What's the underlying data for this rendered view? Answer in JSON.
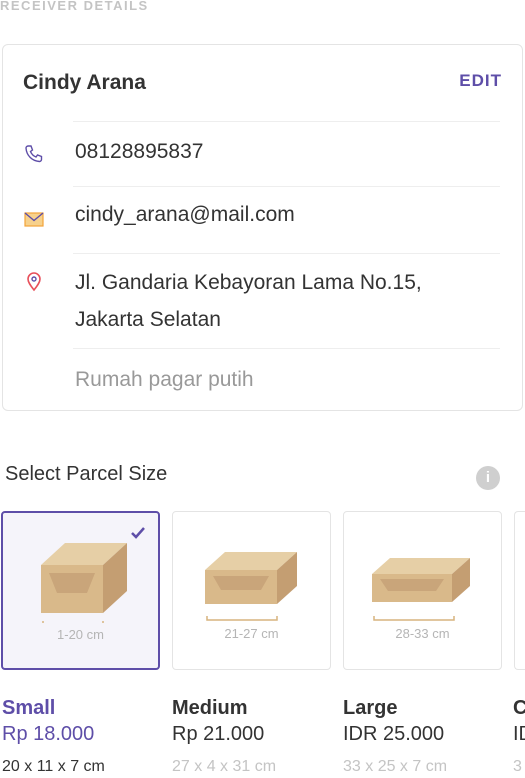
{
  "section_label": "RECEIVER DETAILS",
  "receiver": {
    "name": "Cindy Arana",
    "edit_label": "EDIT",
    "phone": "08128895837",
    "email": "cindy_arana@mail.com",
    "address_line1": "Jl. Gandaria Kebayoran Lama No.15,",
    "address_line2": "Jakarta Selatan",
    "note": "Rumah pagar putih"
  },
  "parcel": {
    "title": "Select Parcel Size",
    "info_icon": "i",
    "sizes": [
      {
        "name": "Small",
        "price": "Rp 18.000",
        "dimensions": "20 x 11 x 7 cm",
        "range": "1-20 cm",
        "selected": true
      },
      {
        "name": "Medium",
        "price": "Rp 21.000",
        "dimensions": "27 x 4 x 31 cm",
        "range": "21-27 cm",
        "selected": false
      },
      {
        "name": "Large",
        "price": "IDR 25.000",
        "dimensions": "33 x 25 x 7 cm",
        "range": "28-33 cm",
        "selected": false
      },
      {
        "name": "C",
        "price": "ID",
        "dimensions": "3",
        "range": "",
        "selected": false
      }
    ]
  },
  "colors": {
    "accent": "#5e4ea8",
    "location_pin": "#e8505b",
    "email_icon": "#f2a33a",
    "muted_text": "#c4c4c4"
  }
}
